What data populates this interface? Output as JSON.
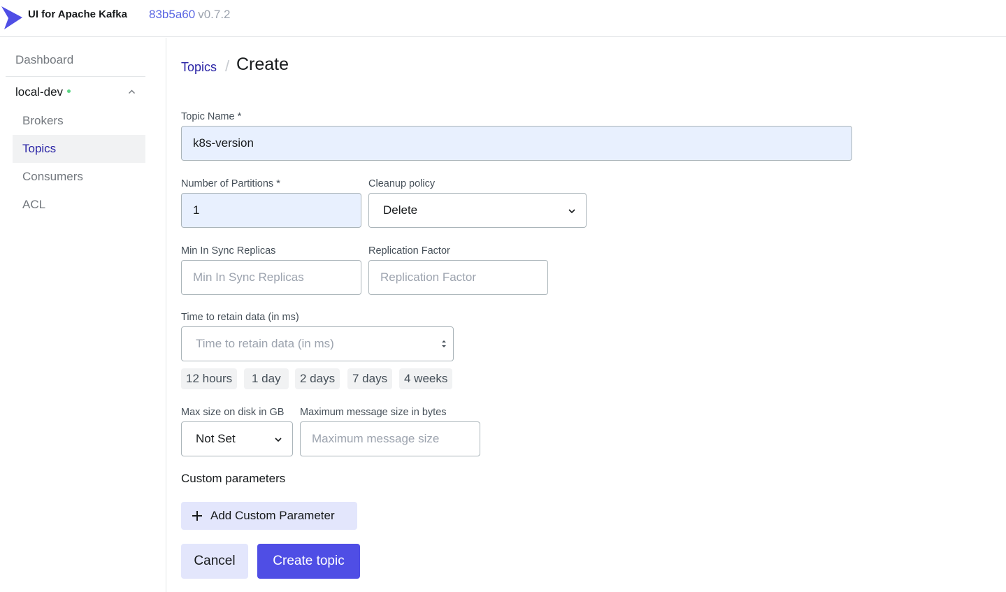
{
  "header": {
    "app_title": "UI for Apache Kafka",
    "version_hash": "83b5a60",
    "version_tag": "v0.7.2"
  },
  "sidebar": {
    "dashboard": "Dashboard",
    "cluster_name": "local-dev",
    "cluster_status": "online",
    "items": [
      {
        "label": "Brokers",
        "active": false
      },
      {
        "label": "Topics",
        "active": true
      },
      {
        "label": "Consumers",
        "active": false
      },
      {
        "label": "ACL",
        "active": false
      }
    ]
  },
  "breadcrumb": {
    "parent": "Topics",
    "current": "Create"
  },
  "form": {
    "topic_name": {
      "label": "Topic Name *",
      "value": "k8s-version"
    },
    "partitions": {
      "label": "Number of Partitions *",
      "value": "1"
    },
    "cleanup_policy": {
      "label": "Cleanup policy",
      "value": "Delete"
    },
    "min_insync": {
      "label": "Min In Sync Replicas",
      "placeholder": "Min In Sync Replicas"
    },
    "replication_factor": {
      "label": "Replication Factor",
      "placeholder": "Replication Factor"
    },
    "retention": {
      "label": "Time to retain data (in ms)",
      "placeholder": "Time to retain data (in ms)",
      "presets": [
        "12 hours",
        "1 day",
        "2 days",
        "7 days",
        "4 weeks"
      ]
    },
    "max_disk": {
      "label": "Max size on disk in GB",
      "value": "Not Set"
    },
    "max_message": {
      "label": "Maximum message size in bytes",
      "placeholder": "Maximum message size"
    },
    "custom_params_title": "Custom parameters",
    "add_param_label": "Add Custom Parameter",
    "cancel_label": "Cancel",
    "submit_label": "Create topic"
  },
  "colors": {
    "accent": "#4f4ee5",
    "link": "#2b25a6",
    "status_online": "#5cd685",
    "autofill_bg": "#e8f0fe"
  }
}
